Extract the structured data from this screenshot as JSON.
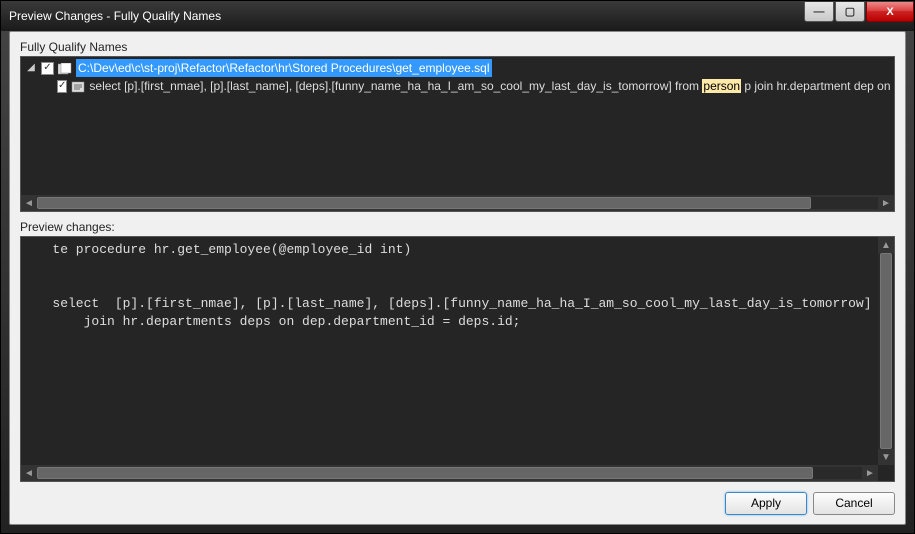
{
  "titlebar": {
    "title": "Preview Changes - Fully Qualify Names"
  },
  "winbtns": {
    "min": "—",
    "max": "▢",
    "close": "X"
  },
  "labels": {
    "section1": "Fully Qualify Names",
    "section2": "Preview changes:"
  },
  "tree": {
    "root": {
      "expander": "◢",
      "check": "✓",
      "path": "C:\\Dev\\ed\\c\\st-proj\\Refactor\\Refactor\\hr\\Stored Procedures\\get_employee.sql"
    },
    "child": {
      "check": "✓",
      "pre": "select  [p].[first_nmae], [p].[last_name], [deps].[funny_name_ha_ha_I_am_so_cool_my_last_day_is_tomorrow] from ",
      "hl": "person",
      "post": " p join hr.department dep on p."
    }
  },
  "preview": {
    "line1": "   te procedure hr.get_employee(@employee_id int)",
    "line2": "",
    "line3": "",
    "line4": "   select  [p].[first_nmae], [p].[last_name], [deps].[funny_name_ha_ha_I_am_so_cool_my_last_day_is_tomorrow] from [dbo].[",
    "line5": "       join hr.departments deps on dep.department_id = deps.id;"
  },
  "buttons": {
    "apply": "Apply",
    "cancel": "Cancel"
  }
}
